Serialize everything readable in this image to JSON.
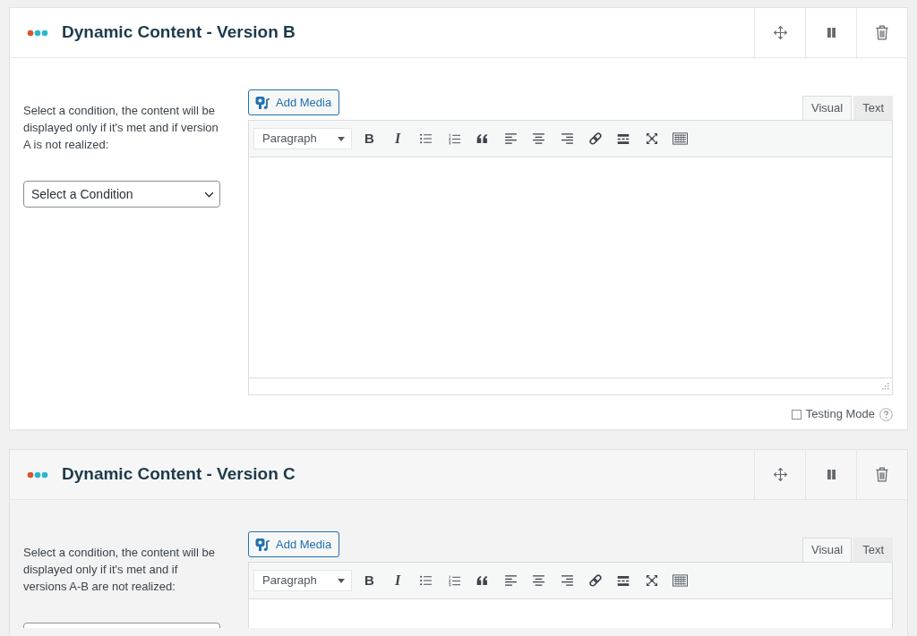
{
  "panels": [
    {
      "title": "Dynamic Content - Version B",
      "active": true,
      "description": "Select a condition, the content will be displayed only if it's met and if version A is not realized:",
      "condition_select": "Select a Condition",
      "editor": {
        "add_media": "Add Media",
        "tabs": [
          {
            "label": "Visual",
            "selected": true
          },
          {
            "label": "Text",
            "selected": false
          }
        ],
        "format_select": "Paragraph",
        "bold_button": "B",
        "italic_button": "I"
      },
      "testing_mode": {
        "label": "Testing Mode",
        "checked": false
      }
    },
    {
      "title": "Dynamic Content - Version C",
      "active": false,
      "description": "Select a condition, the content will be displayed only if it's met and if versions A-B are not realized:",
      "editor": {
        "add_media": "Add Media",
        "tabs": [
          {
            "label": "Visual",
            "selected": true
          },
          {
            "label": "Text",
            "selected": false
          }
        ],
        "format_select": "Paragraph",
        "bold_button": "B",
        "italic_button": "I"
      }
    }
  ]
}
